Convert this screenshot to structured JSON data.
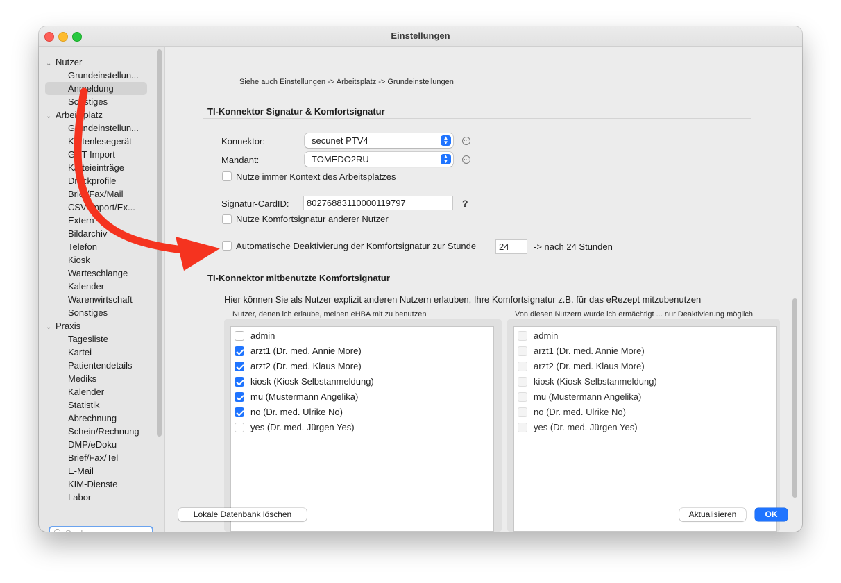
{
  "window": {
    "title": "Einstellungen"
  },
  "sidebar": {
    "items": [
      {
        "label": "Nutzer",
        "group": true
      },
      {
        "label": "Grundeinstellun...",
        "group": false
      },
      {
        "label": "Anmeldung",
        "group": false,
        "selected": true
      },
      {
        "label": "Sonstiges",
        "group": false
      },
      {
        "label": "Arbeitsplatz",
        "group": true
      },
      {
        "label": "Grundeinstellun...",
        "group": false
      },
      {
        "label": "Kartenlesegerät",
        "group": false
      },
      {
        "label": "GDT-Import",
        "group": false
      },
      {
        "label": "Karteieinträge",
        "group": false
      },
      {
        "label": "Druckprofile",
        "group": false
      },
      {
        "label": "Brief/Fax/Mail",
        "group": false
      },
      {
        "label": "CSV-Import/Ex...",
        "group": false
      },
      {
        "label": "Extern",
        "group": false
      },
      {
        "label": "Bildarchiv",
        "group": false
      },
      {
        "label": "Telefon",
        "group": false
      },
      {
        "label": "Kiosk",
        "group": false
      },
      {
        "label": "Warteschlange",
        "group": false
      },
      {
        "label": "Kalender",
        "group": false
      },
      {
        "label": "Warenwirtschaft",
        "group": false
      },
      {
        "label": "Sonstiges",
        "group": false
      },
      {
        "label": "Praxis",
        "group": true
      },
      {
        "label": "Tagesliste",
        "group": false
      },
      {
        "label": "Kartei",
        "group": false
      },
      {
        "label": "Patientendetails",
        "group": false
      },
      {
        "label": "Mediks",
        "group": false
      },
      {
        "label": "Kalender",
        "group": false
      },
      {
        "label": "Statistik",
        "group": false
      },
      {
        "label": "Abrechnung",
        "group": false
      },
      {
        "label": "Schein/Rechnung",
        "group": false
      },
      {
        "label": "DMP/eDoku",
        "group": false
      },
      {
        "label": "Brief/Fax/Tel",
        "group": false
      },
      {
        "label": "E-Mail",
        "group": false
      },
      {
        "label": "KIM-Dienste",
        "group": false
      },
      {
        "label": "Labor",
        "group": false
      }
    ],
    "search_placeholder": "Suche"
  },
  "main": {
    "hint": "Siehe auch Einstellungen -> Arbeitsplatz -> Grundeinstellungen",
    "section1": {
      "title": "TI-Konnektor Signatur & Komfortsignatur",
      "konnektor_label": "Konnektor:",
      "konnektor_value": "secunet PTV4",
      "mandant_label": "Mandant:",
      "mandant_value": "TOMEDO2RU",
      "context_checkbox": "Nutze immer Kontext des Arbeitsplatzes",
      "cardid_label": "Signatur-CardID:",
      "cardid_value": "80276883110000119797",
      "help": "?",
      "other_users_checkbox": "Nutze Komfortsignatur anderer Nutzer",
      "auto_deactivate_checkbox": "Automatische Deaktivierung der Komfortsignatur zur Stunde",
      "hour_value": "24",
      "after_text": "-> nach 24 Stunden"
    },
    "section2": {
      "title": "TI-Konnektor mitbenutzte Komfortsignatur",
      "description": "Hier können Sie als Nutzer explizit anderen Nutzern erlauben, Ihre Komfortsignatur z.B. für das eRezept mitzubenutzen",
      "left_list_label": "Nutzer, denen ich erlaube, meinen eHBA mit zu benutzen",
      "right_list_label": "Von diesen Nutzern wurde ich ermächtigt ... nur Deaktivierung möglich",
      "left_items": [
        {
          "label": "admin",
          "checked": false
        },
        {
          "label": "arzt1 (Dr. med. Annie More)",
          "checked": true
        },
        {
          "label": "arzt2 (Dr. med. Klaus More)",
          "checked": true
        },
        {
          "label": "kiosk (Kiosk Selbstanmeldung)",
          "checked": true
        },
        {
          "label": "mu (Mustermann Angelika)",
          "checked": true
        },
        {
          "label": "no (Dr. med. Ulrike No)",
          "checked": true
        },
        {
          "label": "yes (Dr. med. Jürgen Yes)",
          "checked": false
        }
      ],
      "right_items": [
        {
          "label": "admin",
          "checked": false
        },
        {
          "label": "arzt1 (Dr. med. Annie More)",
          "checked": false
        },
        {
          "label": "arzt2 (Dr. med. Klaus More)",
          "checked": false
        },
        {
          "label": "kiosk (Kiosk Selbstanmeldung)",
          "checked": false
        },
        {
          "label": "mu (Mustermann Angelika)",
          "checked": false
        },
        {
          "label": "no (Dr. med. Ulrike No)",
          "checked": false
        },
        {
          "label": "yes (Dr. med. Jürgen Yes)",
          "checked": false
        }
      ]
    }
  },
  "footer": {
    "delete_db_button": "Lokale Datenbank löschen",
    "refresh_button": "Aktualisieren",
    "ok_button": "OK"
  },
  "colors": {
    "accent": "#1f74ff",
    "annotation_arrow": "#f5331f"
  }
}
